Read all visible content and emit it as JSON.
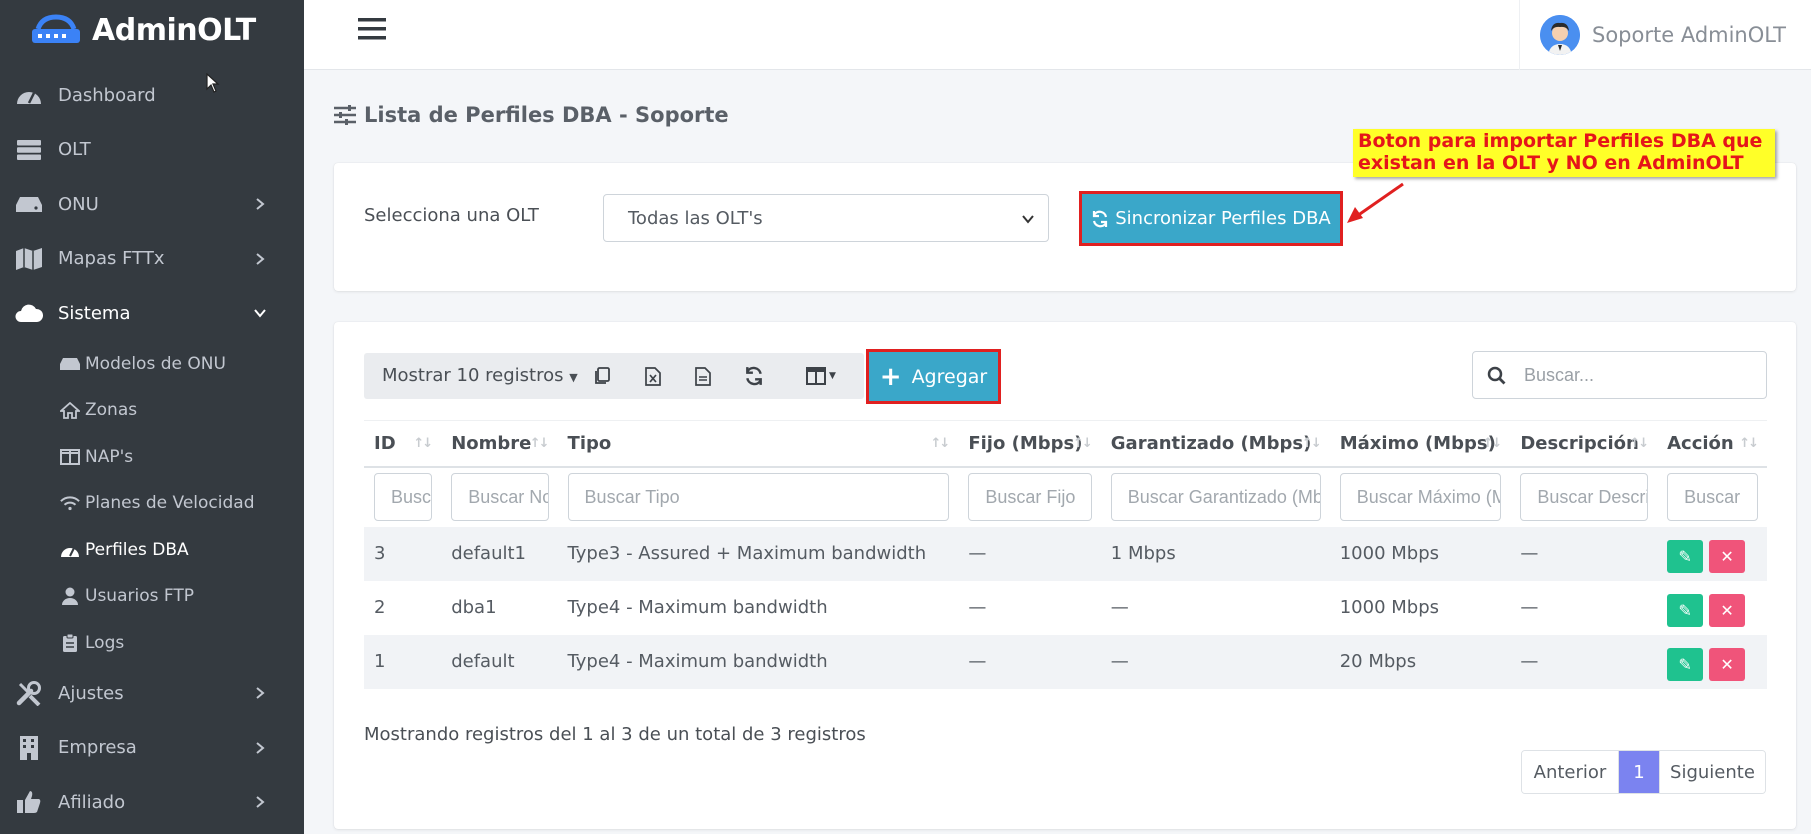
{
  "brand": {
    "name": "AdminOLT"
  },
  "sidebar": {
    "items": [
      {
        "label": "Dashboard"
      },
      {
        "label": "OLT"
      },
      {
        "label": "ONU"
      },
      {
        "label": "Mapas FTTx"
      },
      {
        "label": "Sistema"
      },
      {
        "label": "Ajustes"
      },
      {
        "label": "Empresa"
      },
      {
        "label": "Afiliado"
      }
    ],
    "sistema_sub": [
      {
        "label": "Modelos de ONU"
      },
      {
        "label": "Zonas"
      },
      {
        "label": "NAP's"
      },
      {
        "label": "Planes de Velocidad"
      },
      {
        "label": "Perfiles DBA"
      },
      {
        "label": "Usuarios FTP"
      },
      {
        "label": "Logs"
      }
    ]
  },
  "topbar": {
    "user_name": "Soporte AdminOLT"
  },
  "page": {
    "title": "Lista de Perfiles DBA - Soporte"
  },
  "olt_filter": {
    "label": "Selecciona una OLT",
    "selected": "Todas las OLT's"
  },
  "sync_button": {
    "label": "Sincronizar Perfiles DBA"
  },
  "callout": {
    "text": "Boton para importar Perfiles DBA que existan en la OLT y NO en AdminOLT"
  },
  "toolbar": {
    "show_label": "Mostrar 10 registros",
    "add_label": "Agregar"
  },
  "search": {
    "placeholder": "Buscar..."
  },
  "table": {
    "headers": [
      "ID",
      "Nombre",
      "Tipo",
      "Fijo (Mbps)",
      "Garantizado (Mbps)",
      "Máximo (Mbps)",
      "Descripción",
      "Acción"
    ],
    "filter_placeholders": [
      "Buscar ID",
      "Buscar Nombre",
      "Buscar Tipo",
      "Buscar Fijo",
      "Buscar Garantizado (Mbps)",
      "Buscar Máximo (Mbps)",
      "Buscar Descripción",
      "Buscar"
    ],
    "rows": [
      {
        "id": "3",
        "nombre": "default1",
        "tipo": "Type3 - Assured + Maximum bandwidth",
        "fijo": "—",
        "garantizado": "1 Mbps",
        "maximo": "1000 Mbps",
        "descripcion": "—"
      },
      {
        "id": "2",
        "nombre": "dba1",
        "tipo": "Type4 - Maximum bandwidth",
        "fijo": "—",
        "garantizado": "—",
        "maximo": "1000 Mbps",
        "descripcion": "—"
      },
      {
        "id": "1",
        "nombre": "default",
        "tipo": "Type4 - Maximum bandwidth",
        "fijo": "—",
        "garantizado": "—",
        "maximo": "20 Mbps",
        "descripcion": "—"
      }
    ]
  },
  "footer": {
    "info": "Mostrando registros del 1 al 3 de un total de 3 registros"
  },
  "pagination": {
    "prev": "Anterior",
    "current": "1",
    "next": "Siguiente"
  },
  "colors": {
    "sidebar_bg": "#343a40",
    "accent_button": "#3aa7c9",
    "highlight_border": "#e02020",
    "callout_bg": "#ffff28",
    "callout_text": "#e5151a",
    "edit": "#1fc28f",
    "delete": "#f0547a",
    "page_active": "#7b83f0"
  }
}
